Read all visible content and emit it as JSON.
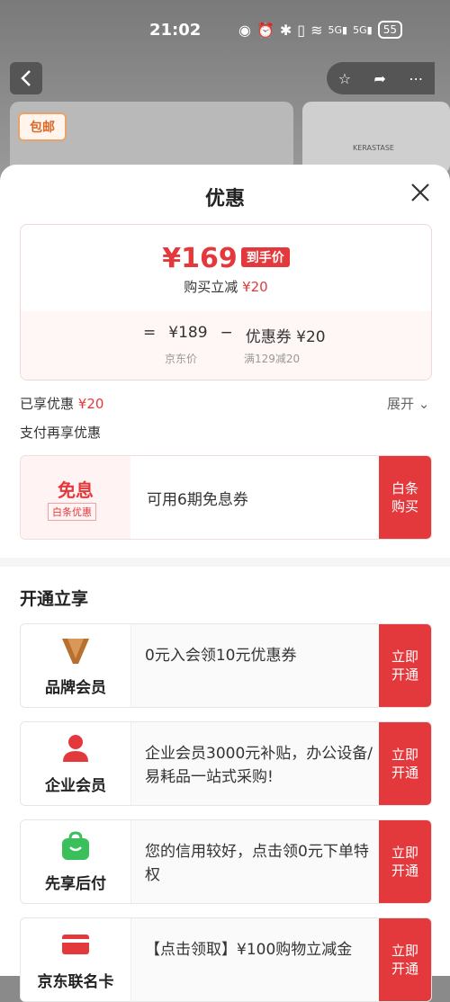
{
  "status_bar": {
    "time": "21:02",
    "signal1": "5G",
    "signal2": "5G",
    "battery": "55"
  },
  "header": {
    "back_icon": "chevron-left-icon"
  },
  "product": {
    "badge": "包邮",
    "brand_tiny": "KERASTASE"
  },
  "sheet": {
    "title": "优惠",
    "price": "¥169",
    "price_tag": "到手价",
    "instant_label": "购买立减",
    "instant_value": "¥20",
    "calc": {
      "eq": "=",
      "jd_price": "¥189",
      "minus": "−",
      "coupon": "优惠券 ¥20",
      "jd_label": "京东价",
      "coupon_rule": "满129减20"
    },
    "enjoyed_label": "已享优惠",
    "enjoyed_value": "¥20",
    "expand": "展开 ⌄",
    "pay_more": "支付再享优惠",
    "mianxi": {
      "title": "免息",
      "tag": "白条优惠",
      "text": "可用6期免息券",
      "button": "白条\n购买"
    },
    "section_title": "开通立享",
    "members": [
      {
        "label": "品牌会员",
        "text": "0元入会领10元优惠券",
        "button": "立即\n开通"
      },
      {
        "label": "企业会员",
        "text": " 企业会员3000元补贴，办公设备/易耗品一站式采购!",
        "button": "立即\n开通"
      },
      {
        "label": "先享后付",
        "text": "您的信用较好，点击领0元下单特权",
        "button": "立即\n开通"
      },
      {
        "label": "京东联名卡",
        "text": "【点击领取】¥100购物立减金",
        "button": "立即\n开通"
      }
    ]
  },
  "colors": {
    "accent": "#e4393c"
  }
}
